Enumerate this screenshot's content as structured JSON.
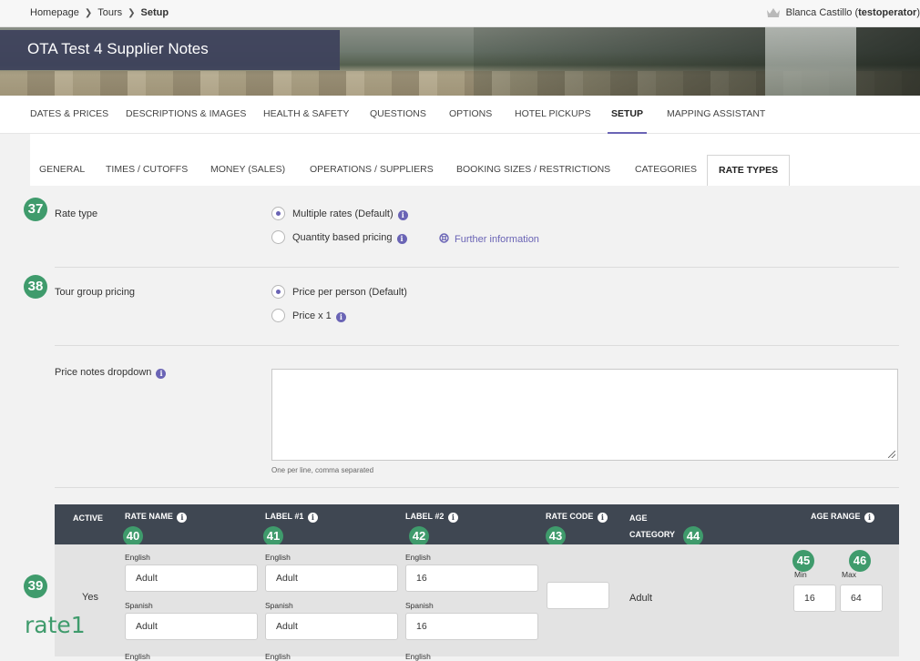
{
  "breadcrumb": {
    "home": "Homepage",
    "tours": "Tours",
    "current": "Setup",
    "sep": "❯"
  },
  "user": {
    "name": "Blanca Castillo (",
    "login": "testoperator",
    "close": ")"
  },
  "page": {
    "title": "OTA Test 4 Supplier Notes"
  },
  "mainnav": [
    "DATES & PRICES",
    "DESCRIPTIONS & IMAGES",
    "HEALTH & SAFETY",
    "QUESTIONS",
    "OPTIONS",
    "HOTEL PICKUPS",
    "SETUP",
    "MAPPING ASSISTANT"
  ],
  "subnav": [
    "GENERAL",
    "TIMES / CUTOFFS",
    "MONEY (SALES)",
    "OPERATIONS / SUPPLIERS",
    "BOOKING SIZES / RESTRICTIONS",
    "CATEGORIES",
    "RATE TYPES"
  ],
  "rate_type": {
    "badge": "37",
    "label": "Rate type",
    "option1": "Multiple rates (Default)",
    "option2": "Quantity based pricing",
    "link": "Further information",
    "selected": "Multiple rates (Default)"
  },
  "group_pricing": {
    "badge": "38",
    "label": "Tour group pricing",
    "option1": "Price per person (Default)",
    "option2": "Price x 1",
    "selected": "Price per person (Default)"
  },
  "price_notes": {
    "label": "Price notes dropdown",
    "value": "",
    "hint": "One per line, comma separated"
  },
  "table": {
    "headers": {
      "active": "ACTIVE",
      "rate_name": "RATE NAME",
      "label1": "LABEL #1",
      "label2": "LABEL #2",
      "rate_code": "RATE CODE",
      "age_category_1": "AGE",
      "age_category_2": "CATEGORY",
      "age_range": "AGE RANGE"
    },
    "badges": {
      "rate_name": "40",
      "label1": "41",
      "label2": "42",
      "rate_code": "43",
      "age_category": "44",
      "min": "45",
      "max": "46",
      "row": "39"
    },
    "row": {
      "active": "Yes",
      "lang1": "English",
      "lang2": "Spanish",
      "rate_name_en": "Adult",
      "rate_name_es": "Adult",
      "label1_en": "Adult",
      "label1_es": "Adult",
      "label2_en": "16",
      "label2_es": "16",
      "rate_code": "",
      "age_category": "Adult",
      "min_label": "Min",
      "max_label": "Max",
      "min": "16",
      "max": "64"
    },
    "next_row_langs": [
      "English",
      "English",
      "English"
    ]
  },
  "annotation": {
    "rate1": "rate1"
  },
  "colors": {
    "accent": "#6a64b5",
    "badge": "#3f9b6c",
    "table_header": "#3f4752"
  }
}
